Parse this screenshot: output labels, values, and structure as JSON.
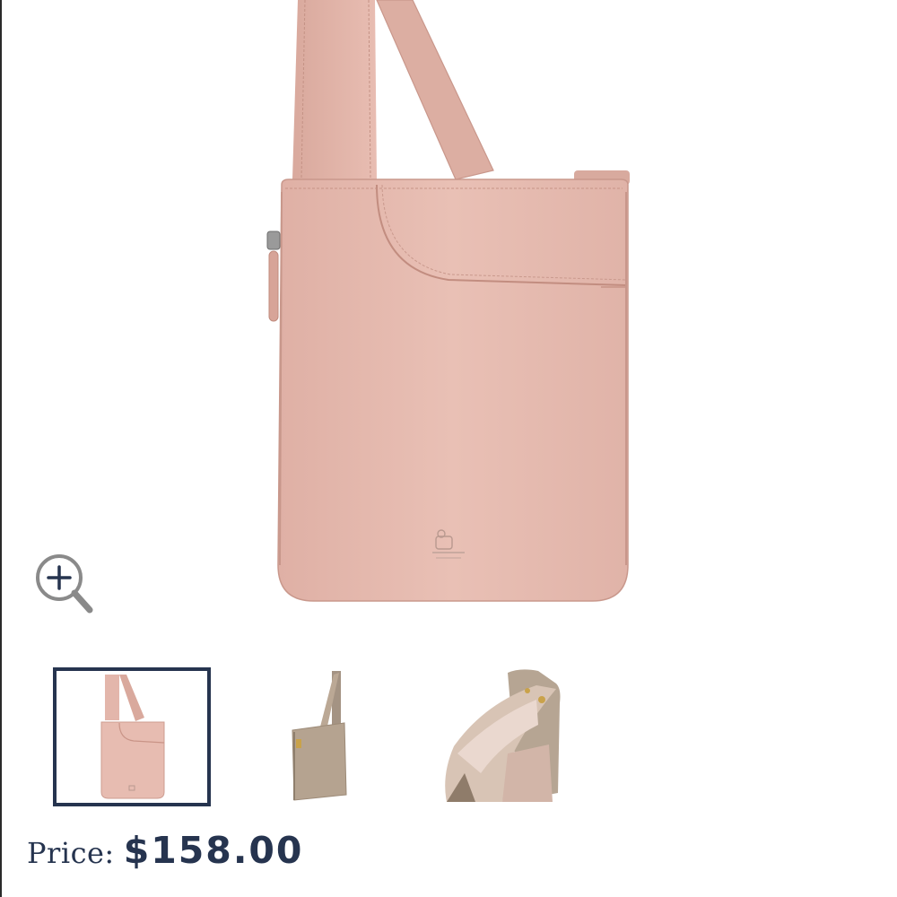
{
  "product": {
    "main_image_icon": "handbag-icon",
    "brand_mark_icon": "dog-logo-icon",
    "color": "#e7bcb1"
  },
  "zoom": {
    "icon": "zoom-in-icon"
  },
  "thumbnails": [
    {
      "icon": "handbag-front-icon",
      "selected": true
    },
    {
      "icon": "handbag-side-icon",
      "selected": false
    },
    {
      "icon": "handbag-interior-icon",
      "selected": false
    }
  ],
  "price": {
    "label": "Price:",
    "value": "$158.00"
  },
  "colors": {
    "accent": "#26344f",
    "thumbnail_border": "#26344f",
    "bag_pink": "#e7bcb1",
    "bag_taupe": "#b8a693"
  }
}
